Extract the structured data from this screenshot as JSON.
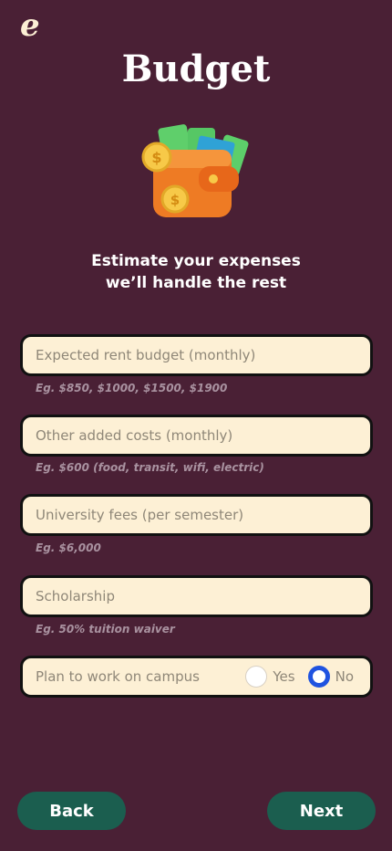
{
  "app": {
    "logo_letter": "e"
  },
  "page": {
    "title": "Budget",
    "subtitle_line1": "Estimate your expenses",
    "subtitle_line2": "we’ll handle the rest"
  },
  "form": {
    "rent": {
      "placeholder": "Expected rent budget (monthly)",
      "hint": "Eg. $850, $1000, $1500, $1900"
    },
    "other_costs": {
      "placeholder": "Other added costs (monthly)",
      "hint": "Eg. $600 (food, transit, wifi, electric)"
    },
    "university_fees": {
      "placeholder": "University fees (per semester)",
      "hint": "Eg. $6,000"
    },
    "scholarship": {
      "placeholder": "Scholarship",
      "hint": "Eg. 50% tuition waiver"
    },
    "work_on_campus": {
      "label": "Plan to work on campus",
      "yes": "Yes",
      "no": "No",
      "selected": "No"
    }
  },
  "nav": {
    "back": "Back",
    "next": "Next"
  },
  "colors": {
    "background": "#4a2035",
    "field": "#fdf0d5",
    "button": "#1b5e4f",
    "radio_selected": "#1f53e0"
  },
  "illustration": {
    "icon": "wallet-with-money-icon"
  }
}
